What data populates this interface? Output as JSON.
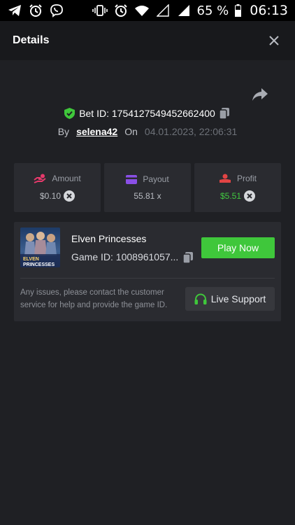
{
  "status_bar": {
    "left_icons": [
      "telegram-icon",
      "alarm-icon",
      "viber-icon"
    ],
    "right_icons": [
      "vibrate-icon",
      "alarm-icon",
      "wifi-icon",
      "signal-empty-icon",
      "signal-icon"
    ],
    "battery_percent": "65 %",
    "time": "06:13"
  },
  "header": {
    "title": "Details",
    "close_icon": "close-icon"
  },
  "bet": {
    "id_label": "Bet ID: 1754127549452662400",
    "by_label": "By",
    "username": "selena42",
    "on_label": "On",
    "date": "04.01.2023, 22:06:31"
  },
  "stats": [
    {
      "label": "Amount",
      "value": "$0.10",
      "icon": "amount-icon",
      "coin": true,
      "color": "#e83a6c"
    },
    {
      "label": "Payout",
      "value": "55.81 x",
      "icon": "payout-card-icon",
      "coin": false,
      "color": "#8a4fe6"
    },
    {
      "label": "Profit",
      "value": "$5.51",
      "icon": "profit-icon",
      "coin": true,
      "color": "#e24444"
    }
  ],
  "game": {
    "name": "Elven Princesses",
    "id_label": "Game ID: 1008961057...",
    "thumb_text_1": "ELVEN",
    "thumb_text_2": "PRINCESSES",
    "play_label": "Play Now",
    "issues_text": "Any issues, please contact the customer service for help and provide the game ID.",
    "support_label": "Live Support"
  },
  "colors": {
    "accent_green": "#3fc73b",
    "background": "#1f2024",
    "card": "#2a2b30"
  }
}
